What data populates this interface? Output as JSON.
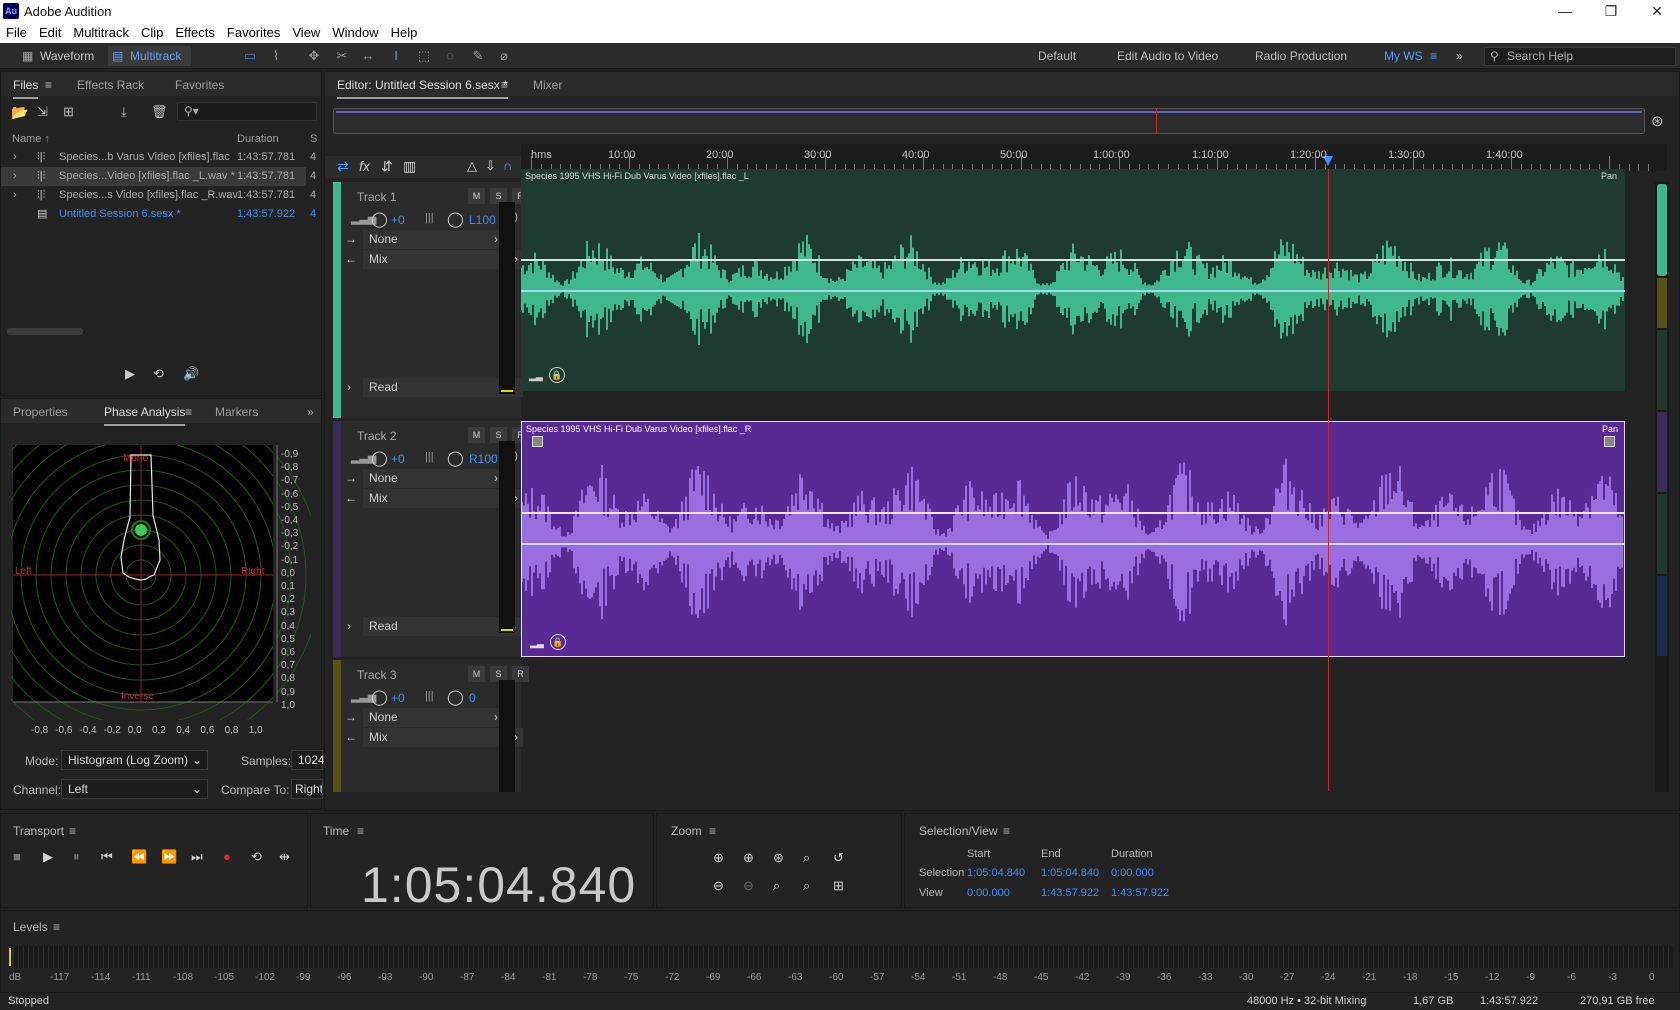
{
  "app": {
    "logo": "Au",
    "title": "Adobe Audition",
    "minimize": "—",
    "maximize": "❐",
    "close": "✕"
  },
  "menu": [
    "File",
    "Edit",
    "Multitrack",
    "Clip",
    "Effects",
    "Favorites",
    "View",
    "Window",
    "Help"
  ],
  "toolbar": {
    "waveform": "Waveform",
    "multitrack": "Multitrack",
    "workspaces": [
      "Default",
      "Edit Audio to Video",
      "Radio Production",
      "My WS"
    ],
    "search_placeholder": "Search Help"
  },
  "files_panel": {
    "tabs": [
      "Files",
      "Effects Rack",
      "Favorites"
    ],
    "columns": {
      "name": "Name",
      "duration": "Duration",
      "channels": "S"
    },
    "rows": [
      {
        "name": "Species...b Varus Video [xfiles].flac",
        "duration": "1:43:57.781",
        "channels": "4"
      },
      {
        "name": "Species...Video [xfiles].flac _L.wav *",
        "duration": "1:43:57.781",
        "channels": "4"
      },
      {
        "name": "Species...s Video [xfiles].flac _R.wav",
        "duration": "1:43:57.781",
        "channels": "4"
      },
      {
        "name": "Untitled Session 6.sesx *",
        "duration": "1:43:57.922",
        "channels": "4"
      }
    ]
  },
  "analysis_panel": {
    "tabs": [
      "Properties",
      "Phase Analysis",
      "Markers"
    ],
    "labels": {
      "mono": "Mono",
      "left": "Left",
      "right": "Right",
      "inverse": "Inverse"
    },
    "y_ticks": [
      "-0,9",
      "-0,8",
      "-0,7",
      "-0,6",
      "-0,5",
      "-0,4",
      "-0,3",
      "-0,2",
      "-0,1",
      "0,0",
      "0,1",
      "0,2",
      "0,3",
      "0,4",
      "0,5",
      "0,6",
      "0,7",
      "0,8",
      "0,9",
      "1,0"
    ],
    "x_ticks": [
      "-0,8",
      "-0,6",
      "-0,4",
      "-0,2",
      "0,0",
      "0,2",
      "0,4",
      "0,6",
      "0,8",
      "1,0"
    ],
    "mode_label": "Mode:",
    "mode_value": "Histogram (Log Zoom)",
    "samples_label": "Samples:",
    "samples_value": "1024",
    "channel_label": "Channel:",
    "channel_value": "Left",
    "compare_label": "Compare To:",
    "compare_value": "Right"
  },
  "editor": {
    "tab": "Editor: Untitled Session 6.sesx *",
    "mixer": "Mixer",
    "ruler": [
      "hms",
      "10:00",
      "20:00",
      "30:00",
      "40:00",
      "50:00",
      "1:00:00",
      "1:10:00",
      "1:20:00",
      "1:30:00",
      "1:40:00"
    ],
    "tracks": [
      {
        "name": "Track 1",
        "vol": "+0",
        "pan": "L100",
        "input": "None",
        "output": "Mix",
        "mode": "Read",
        "clip": "Species 1995 VHS Hi-Fi Dub Varus Video [xfiles].flac _L",
        "pan_label": "Pan",
        "color": "#3fb88c"
      },
      {
        "name": "Track 2",
        "vol": "+0",
        "pan": "R100",
        "input": "None",
        "output": "Mix",
        "mode": "Read",
        "clip": "Species 1995 VHS Hi-Fi Dub Varus Video [xfiles].flac _R",
        "pan_label": "Pan",
        "color": "#6a38b2"
      },
      {
        "name": "Track 3",
        "vol": "+0",
        "pan": "0",
        "input": "None",
        "output": "Mix",
        "color": "#8a7a20"
      }
    ],
    "msr": [
      "M",
      "S",
      "R"
    ]
  },
  "transport": {
    "title": "Transport"
  },
  "time": {
    "title": "Time",
    "value": "1:05:04.840"
  },
  "zoom": {
    "title": "Zoom"
  },
  "selection": {
    "title": "Selection/View",
    "start": "Start",
    "end": "End",
    "duration": "Duration",
    "selection_label": "Selection",
    "view_label": "View",
    "sel_start": "1:05:04.840",
    "sel_end": "1:05:04.840",
    "sel_dur": "0:00.000",
    "view_start": "0:00.000",
    "view_end": "1:43:57.922",
    "view_dur": "1:43:57.922"
  },
  "levels": {
    "title": "Levels",
    "ticks": [
      "dB",
      "-117",
      "-114",
      "-111",
      "-108",
      "-105",
      "-102",
      "-99",
      "-96",
      "-93",
      "-90",
      "-87",
      "-84",
      "-81",
      "-78",
      "-75",
      "-72",
      "-69",
      "-66",
      "-63",
      "-60",
      "-57",
      "-54",
      "-51",
      "-48",
      "-45",
      "-42",
      "-39",
      "-36",
      "-33",
      "-30",
      "-27",
      "-24",
      "-21",
      "-18",
      "-15",
      "-12",
      "-9",
      "-6",
      "-3",
      "0"
    ]
  },
  "status": {
    "state": "Stopped",
    "format": "48000 Hz • 32-bit Mixing",
    "size": "1,67 GB",
    "duration": "1:43:57.922",
    "free": "270,91 GB free"
  },
  "colors": {
    "accent": "#3f8ef5",
    "playhead": "#c0282a",
    "track1": "#3fb88c",
    "track2": "#9b6ee0"
  }
}
